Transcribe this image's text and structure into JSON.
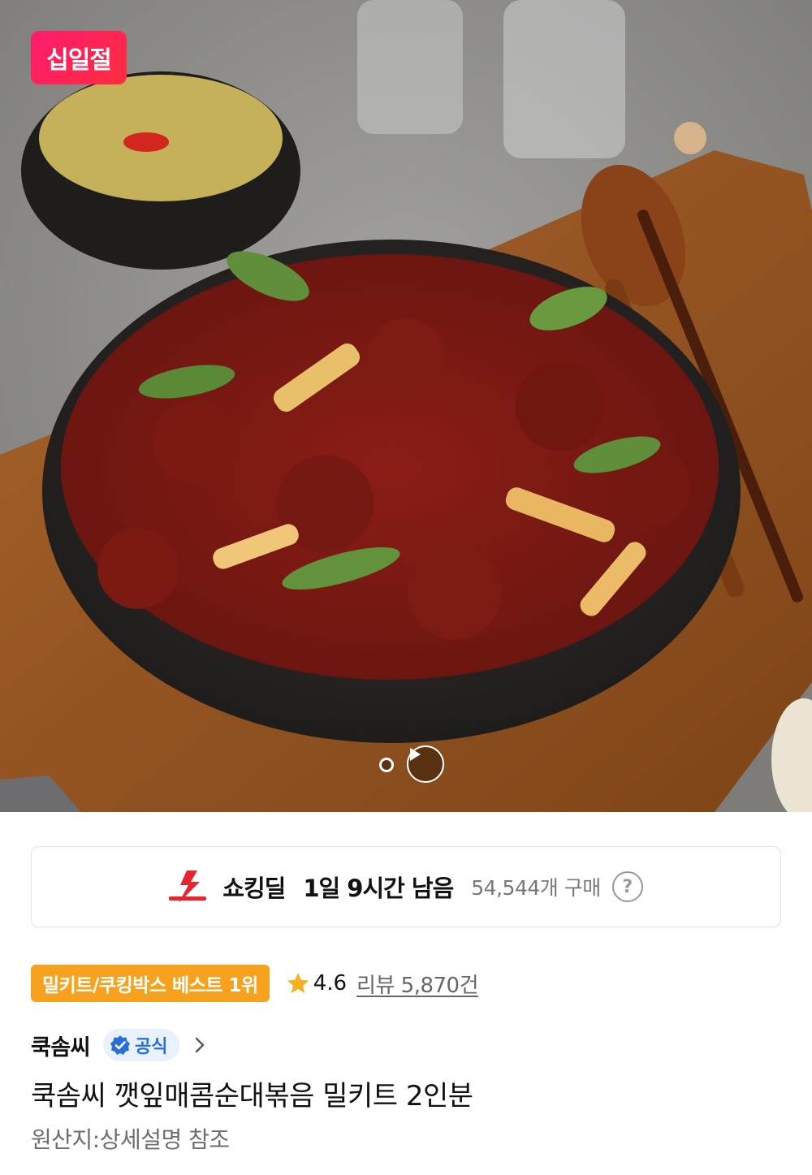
{
  "hero": {
    "event_badge": "십일절",
    "image_alt": "깻잎매콤순대볶음",
    "carousel": {
      "dot_icon": "carousel-dot-icon",
      "play_icon": "play-icon"
    }
  },
  "deal": {
    "icon": "shocking-deal-icon",
    "title": "쇼킹딜",
    "time_left": "1일 9시간 남음",
    "purchase_count": "54,544개 구매",
    "help_icon": "?"
  },
  "rank": {
    "badge": "밀키트/쿠킹박스 베스트 1위"
  },
  "rating": {
    "value": "4.6",
    "review_link": "리뷰 5,870건"
  },
  "seller": {
    "name": "쿡솜씨",
    "official_label": "공식"
  },
  "product": {
    "title": "쿡솜씨 깻잎매콤순대볶음 밀키트 2인분",
    "origin": "원산지:상세설명 참조"
  },
  "colors": {
    "event_badge": "#ff1a6e",
    "rank_badge": "#f6a21e",
    "official_badge_bg": "#e8f1fc",
    "official_text": "#2a6fd8",
    "deal_icon_red": "#e8242f",
    "star": "#f6b01e"
  }
}
